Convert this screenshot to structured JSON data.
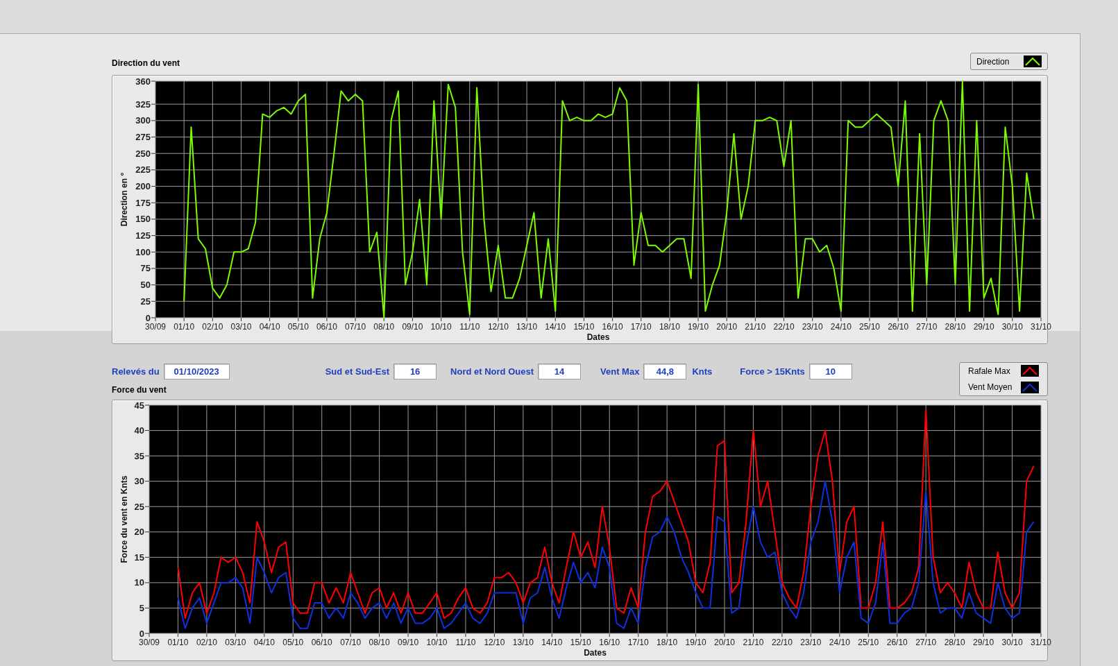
{
  "direction_chart": {
    "chart_data": {
      "type": "line",
      "title": "Direction du vent",
      "xlabel": "Dates",
      "ylabel": "Direction en °",
      "categories": [
        "30/09",
        null,
        null,
        null,
        "01/10",
        null,
        null,
        null,
        "02/10",
        null,
        null,
        null,
        "03/10",
        null,
        null,
        null,
        "04/10",
        null,
        null,
        null,
        "05/10",
        null,
        null,
        null,
        "06/10",
        null,
        null,
        null,
        "07/10",
        null,
        null,
        null,
        "08/10",
        null,
        null,
        null,
        "09/10",
        null,
        null,
        null,
        "10/10",
        null,
        null,
        null,
        "11/10",
        null,
        null,
        null,
        "12/10",
        null,
        null,
        null,
        "13/10",
        null,
        null,
        null,
        "14/10",
        null,
        null,
        null,
        "15/10",
        null,
        null,
        null,
        "16/10",
        null,
        null,
        null,
        "17/10",
        null,
        null,
        null,
        "18/10",
        null,
        null,
        null,
        "19/10",
        null,
        null,
        null,
        "20/10",
        null,
        null,
        null,
        "21/10",
        null,
        null,
        null,
        "22/10",
        null,
        null,
        null,
        "23/10",
        null,
        null,
        null,
        "24/10",
        null,
        null,
        null,
        "25/10",
        null,
        null,
        null,
        "26/10",
        null,
        null,
        null,
        "27/10",
        null,
        null,
        null,
        "28/10",
        null,
        null,
        null,
        "29/10",
        null,
        null,
        null,
        "30/10",
        null,
        null,
        null,
        "31/10"
      ],
      "series": [
        {
          "name": "Direction",
          "color": "#7cfc00",
          "values": [
            null,
            null,
            null,
            null,
            25,
            290,
            120,
            105,
            45,
            30,
            50,
            100,
            100,
            105,
            145,
            310,
            305,
            315,
            320,
            310,
            330,
            340,
            30,
            120,
            160,
            250,
            345,
            330,
            340,
            330,
            100,
            130,
            0,
            300,
            345,
            50,
            100,
            180,
            50,
            330,
            150,
            355,
            320,
            100,
            5,
            350,
            150,
            40,
            110,
            30,
            30,
            60,
            110,
            160,
            30,
            120,
            10,
            330,
            300,
            305,
            300,
            300,
            310,
            305,
            310,
            350,
            330,
            80,
            160,
            110,
            110,
            100,
            110,
            120,
            120,
            60,
            355,
            10,
            50,
            80,
            160,
            280,
            150,
            200,
            300,
            300,
            305,
            300,
            230,
            300,
            30,
            120,
            120,
            100,
            110,
            75,
            10,
            300,
            290,
            290,
            300,
            310,
            300,
            290,
            200,
            330,
            10,
            280,
            50,
            300,
            330,
            300,
            50,
            360,
            10,
            300,
            30,
            60,
            5,
            290,
            200,
            10,
            220,
            150,
            null
          ]
        }
      ],
      "ylim": [
        0,
        360
      ],
      "grid": true,
      "yticks": [
        0,
        25,
        50,
        75,
        100,
        125,
        150,
        175,
        200,
        225,
        250,
        275,
        300,
        325,
        360
      ]
    }
  },
  "readings": [
    {
      "label": "Relevés du",
      "value": "01/10/2023"
    },
    {
      "label": "Sud et Sud-Est",
      "value": "16"
    },
    {
      "label": "Nord et Nord Ouest",
      "value": "14"
    },
    {
      "label": "Vent Max",
      "value": "44,8",
      "unit": "Knts"
    },
    {
      "label": "Force > 15Knts",
      "value": "10"
    }
  ],
  "force_chart": {
    "chart_data": {
      "type": "line",
      "title": "Force du vent",
      "xlabel": "Dates",
      "ylabel": "Force du vent en Knts",
      "categories": [
        "30/09",
        null,
        null,
        null,
        "01/10",
        null,
        null,
        null,
        "02/10",
        null,
        null,
        null,
        "03/10",
        null,
        null,
        null,
        "04/10",
        null,
        null,
        null,
        "05/10",
        null,
        null,
        null,
        "06/10",
        null,
        null,
        null,
        "07/10",
        null,
        null,
        null,
        "08/10",
        null,
        null,
        null,
        "09/10",
        null,
        null,
        null,
        "10/10",
        null,
        null,
        null,
        "11/10",
        null,
        null,
        null,
        "12/10",
        null,
        null,
        null,
        "13/10",
        null,
        null,
        null,
        "14/10",
        null,
        null,
        null,
        "15/10",
        null,
        null,
        null,
        "16/10",
        null,
        null,
        null,
        "17/10",
        null,
        null,
        null,
        "18/10",
        null,
        null,
        null,
        "19/10",
        null,
        null,
        null,
        "20/10",
        null,
        null,
        null,
        "21/10",
        null,
        null,
        null,
        "22/10",
        null,
        null,
        null,
        "23/10",
        null,
        null,
        null,
        "24/10",
        null,
        null,
        null,
        "25/10",
        null,
        null,
        null,
        "26/10",
        null,
        null,
        null,
        "27/10",
        null,
        null,
        null,
        "28/10",
        null,
        null,
        null,
        "29/10",
        null,
        null,
        null,
        "30/10",
        null,
        null,
        null,
        "31/10"
      ],
      "series": [
        {
          "name": "Rafale Max",
          "color": "#ff0000",
          "values": [
            null,
            null,
            null,
            null,
            13,
            3,
            8,
            10,
            4,
            8,
            15,
            14,
            15,
            12,
            6,
            22,
            18,
            12,
            17,
            18,
            6,
            4,
            4,
            10,
            10,
            6,
            9,
            6,
            12,
            8,
            4,
            8,
            9,
            5,
            8,
            4,
            8,
            4,
            4,
            6,
            8,
            3,
            4,
            7,
            9,
            5,
            4,
            6,
            11,
            11,
            12,
            10,
            6,
            10,
            11,
            17,
            10,
            6,
            13,
            20,
            15,
            18,
            13,
            25,
            17,
            5,
            4,
            9,
            5,
            20,
            27,
            28,
            30,
            26,
            22,
            18,
            10,
            8,
            14,
            37,
            38,
            8,
            10,
            22,
            40,
            25,
            30,
            20,
            10,
            7,
            5,
            12,
            25,
            35,
            40,
            30,
            12,
            22,
            25,
            5,
            5,
            10,
            22,
            5,
            5,
            6,
            8,
            13,
            44,
            15,
            8,
            10,
            8,
            5,
            14,
            8,
            5,
            5,
            16,
            8,
            5,
            8,
            30,
            33,
            null
          ]
        },
        {
          "name": "Vent Moyen",
          "color": "#1030e0",
          "values": [
            null,
            null,
            null,
            null,
            7,
            1,
            5,
            7,
            2,
            6,
            10,
            10,
            11,
            9,
            2,
            15,
            12,
            8,
            11,
            12,
            3,
            1,
            1,
            6,
            6,
            3,
            5,
            3,
            8,
            6,
            3,
            5,
            6,
            3,
            6,
            2,
            5,
            2,
            2,
            3,
            5,
            1,
            2,
            4,
            6,
            3,
            2,
            4,
            8,
            8,
            8,
            8,
            2,
            7,
            8,
            13,
            7,
            3,
            9,
            14,
            10,
            12,
            9,
            17,
            13,
            2,
            1,
            5,
            2,
            13,
            19,
            20,
            23,
            20,
            15,
            12,
            8,
            5,
            5,
            23,
            22,
            4,
            5,
            17,
            25,
            18,
            15,
            16,
            8,
            5,
            3,
            8,
            18,
            22,
            30,
            22,
            8,
            15,
            18,
            3,
            2,
            6,
            18,
            2,
            2,
            4,
            5,
            10,
            28,
            10,
            4,
            5,
            5,
            3,
            8,
            4,
            3,
            2,
            10,
            5,
            3,
            4,
            20,
            22,
            null
          ]
        }
      ],
      "ylim": [
        0,
        45
      ],
      "grid": true,
      "yticks": [
        0,
        5,
        10,
        15,
        20,
        25,
        30,
        35,
        40,
        45
      ]
    }
  }
}
